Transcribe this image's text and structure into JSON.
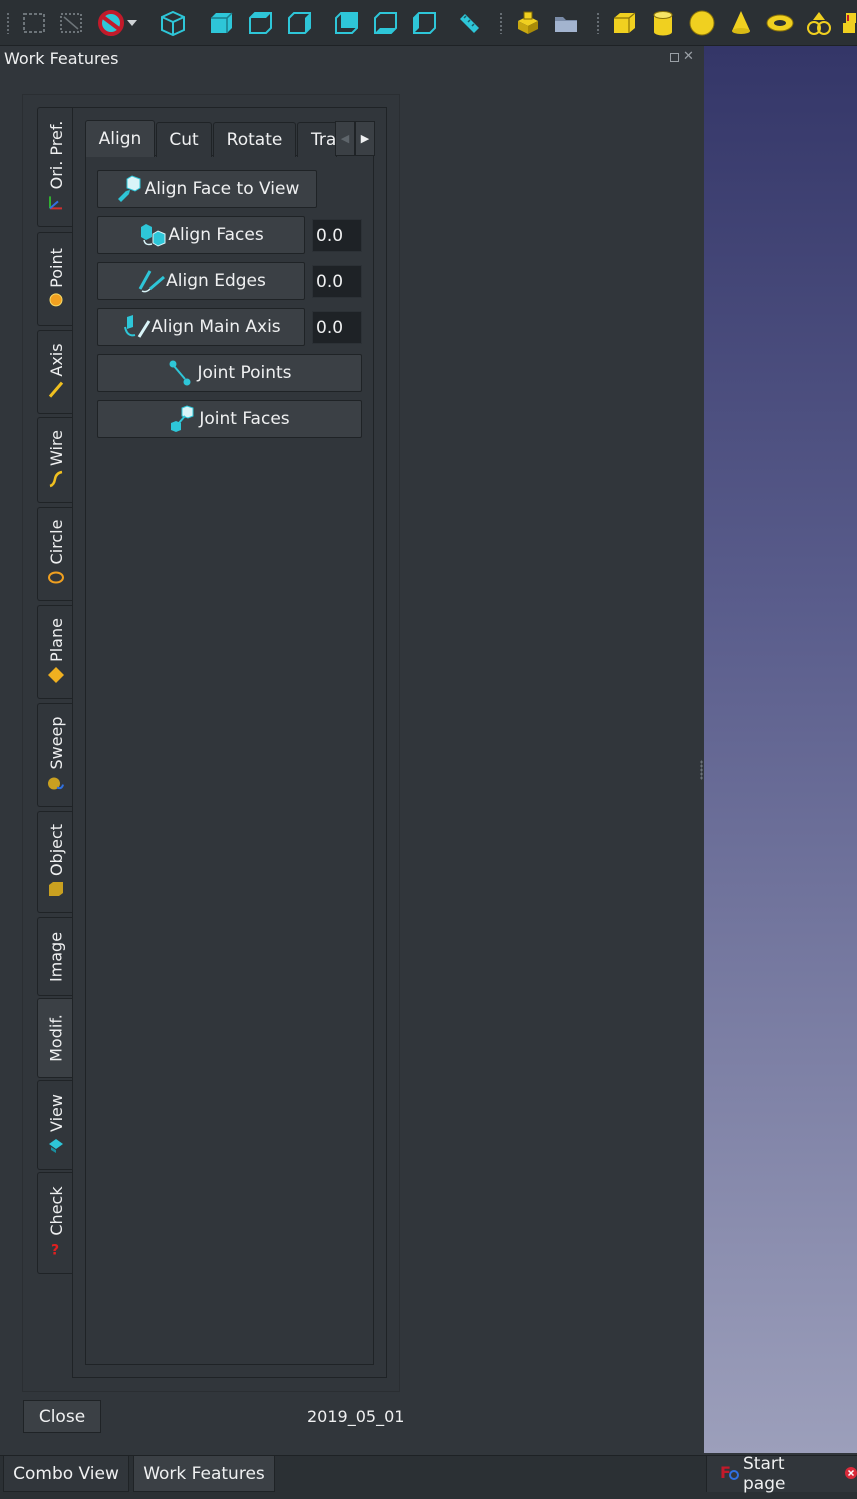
{
  "toolbar": {
    "icons": [
      "box-select-icon",
      "box-select-dashed-icon",
      "no-draw-style-icon",
      "dropdown-arrow-icon",
      "view-isometric-icon",
      "view-front-icon",
      "view-top-icon",
      "view-right-icon",
      "view-rear-icon",
      "view-bottom-icon",
      "view-left-icon",
      "measure-ruler-icon",
      "part-icon",
      "group-folder-icon",
      "cube-icon",
      "cylinder-icon",
      "sphere-icon",
      "cone-icon",
      "torus-icon",
      "primitives-icon",
      "shape-builder-icon"
    ]
  },
  "dock": {
    "title": "Work Features"
  },
  "side_tabs": [
    {
      "label": "Ori. Pref.",
      "icon": "axes-icon"
    },
    {
      "label": "Point",
      "icon": "point-icon"
    },
    {
      "label": "Axis",
      "icon": "axis-icon"
    },
    {
      "label": "Wire",
      "icon": "wire-icon"
    },
    {
      "label": "Circle",
      "icon": "circle-icon"
    },
    {
      "label": "Plane",
      "icon": "plane-icon"
    },
    {
      "label": "Sweep",
      "icon": "sweep-icon"
    },
    {
      "label": "Object",
      "icon": "object-icon"
    },
    {
      "label": "Image",
      "icon": ""
    },
    {
      "label": "Modif.",
      "icon": ""
    },
    {
      "label": "View",
      "icon": "view-icon"
    },
    {
      "label": "Check",
      "icon": "check-icon"
    }
  ],
  "tabs": [
    {
      "label": "Align"
    },
    {
      "label": "Cut"
    },
    {
      "label": "Rotate"
    },
    {
      "label": "Tra"
    }
  ],
  "actions": {
    "align_face_to_view": "Align Face to View",
    "align_faces": "Align Faces",
    "align_faces_value": "0.0",
    "align_edges": "Align Edges",
    "align_edges_value": "0.0",
    "align_main_axis": "Align Main Axis",
    "align_main_axis_value": "0.0",
    "joint_points": "Joint Points",
    "joint_faces": "Joint Faces"
  },
  "footer": {
    "close_label": "Close",
    "version": "2019_05_01"
  },
  "bottom_tabs": {
    "combo_view": "Combo View",
    "work_features": "Work Features",
    "start_page": "Start page"
  },
  "colors": {
    "background": "#31363b",
    "accent_cyan": "#2ec6d8",
    "accent_yellow": "#f0d020",
    "viewport_top": "#343668",
    "viewport_bottom": "#9c9fbb"
  }
}
